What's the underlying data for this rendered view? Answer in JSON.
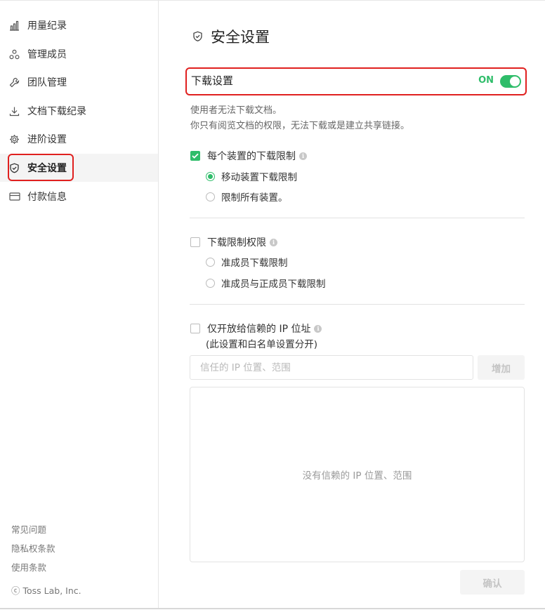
{
  "sidebar": {
    "items": [
      {
        "label": "用量纪录",
        "icon": "bar-chart-icon"
      },
      {
        "label": "管理成员",
        "icon": "members-icon"
      },
      {
        "label": "团队管理",
        "icon": "wrench-icon"
      },
      {
        "label": "文档下载纪录",
        "icon": "download-icon"
      },
      {
        "label": "进阶设置",
        "icon": "gear-icon"
      },
      {
        "label": "安全设置",
        "icon": "shield-icon",
        "active": true
      },
      {
        "label": "付款信息",
        "icon": "credit-card-icon"
      }
    ],
    "footer": {
      "faq": "常见问题",
      "privacy": "隐私权条款",
      "terms": "使用条款",
      "copyright": "ⓒ Toss Lab, Inc."
    }
  },
  "main": {
    "title": "安全设置",
    "download_settings": {
      "title": "下载设置",
      "toggle_state": "ON",
      "desc_line1": "使用者无法下载文档。",
      "desc_line2": "你只有阅览文档的权限，无法下载或是建立共享链接。"
    },
    "device_limit": {
      "label": "每个装置的下载限制",
      "checked": true,
      "options": [
        {
          "label": "移动装置下载限制",
          "selected": true
        },
        {
          "label": "限制所有装置。",
          "selected": false
        }
      ]
    },
    "permission_limit": {
      "label": "下载限制权限",
      "checked": false,
      "options": [
        {
          "label": "准成员下载限制",
          "selected": false
        },
        {
          "label": "准成员与正成员下载限制",
          "selected": false
        }
      ]
    },
    "trusted_ip": {
      "label": "仅开放给信赖的 IP 位址",
      "note": "(此设置和白名单设置分开)",
      "checked": false,
      "input_placeholder": "信任的 IP 位置、范围",
      "add_label": "增加",
      "empty_text": "没有信赖的 IP 位置、范围"
    },
    "confirm_label": "确认"
  },
  "colors": {
    "accent": "#2fbd6a",
    "highlight": "#e0201f"
  }
}
